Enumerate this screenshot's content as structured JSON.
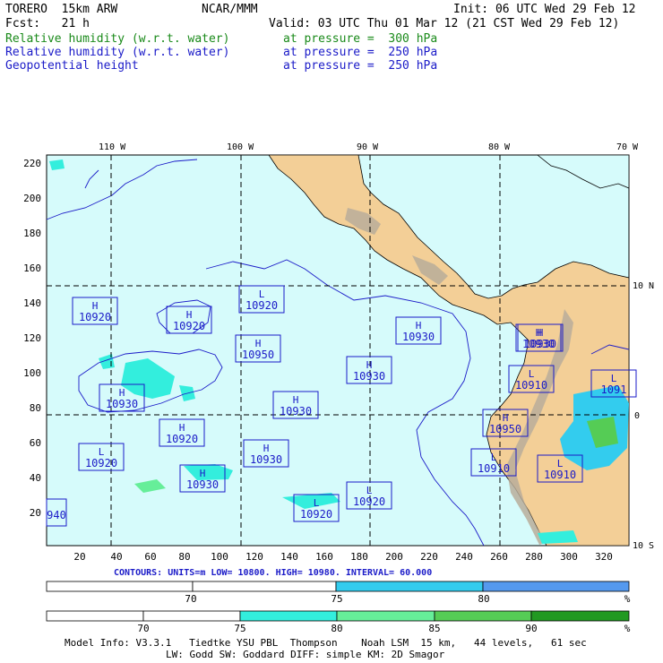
{
  "header": {
    "model": "TORERO  15km ARW",
    "org": "NCAR/MMM",
    "init": "Init: 06 UTC Wed 29 Feb 12",
    "fcst": "Fcst:   21 h",
    "valid": "Valid: 03 UTC Thu 01 Mar 12 (21 CST Wed 29 Feb 12)",
    "fields": [
      {
        "name": "Relative humidity (w.r.t. water)",
        "level": "at pressure =  300 hPa",
        "color": "#1a8a1a"
      },
      {
        "name": "Relative humidity (w.r.t. water)",
        "level": "at pressure =  250 hPa",
        "color": "#1b1bc8"
      },
      {
        "name": "Geopotential height",
        "level": "at pressure =  250 hPa",
        "color": "#1b1bc8"
      }
    ]
  },
  "map": {
    "lon_labels": [
      "110 W",
      "100 W",
      "90 W",
      "80 W",
      "70 W"
    ],
    "lat_labels": [
      "10 N",
      "0",
      "10 S"
    ],
    "x_ticks": [
      "20",
      "40",
      "60",
      "80",
      "100",
      "120",
      "140",
      "160",
      "180",
      "200",
      "220",
      "240",
      "260",
      "280",
      "300",
      "320"
    ],
    "y_ticks": [
      "220",
      "200",
      "180",
      "160",
      "140",
      "120",
      "100",
      "80",
      "60",
      "40",
      "20"
    ],
    "ocean_color": "#d6fbfb",
    "land_color": "#f3cf97",
    "centers": [
      {
        "type": "H",
        "value": "10920"
      },
      {
        "type": "H",
        "value": "10920"
      },
      {
        "type": "L",
        "value": "10920"
      },
      {
        "type": "H",
        "value": "10950"
      },
      {
        "type": "H",
        "value": "10930"
      },
      {
        "type": "H",
        "value": "10930"
      },
      {
        "type": "H",
        "value": "10930"
      },
      {
        "type": "H",
        "value": "10930"
      },
      {
        "type": "H",
        "value": "10930"
      },
      {
        "type": "H",
        "value": "10920"
      },
      {
        "type": "L",
        "value": "10920"
      },
      {
        "type": "H",
        "value": "10930"
      },
      {
        "type": "H",
        "value": "10930"
      },
      {
        "type": "L",
        "value": "10920"
      },
      {
        "type": "L",
        "value": "10920"
      },
      {
        "type": "H",
        "value": "10930"
      },
      {
        "type": "L",
        "value": "10910"
      },
      {
        "type": "H",
        "value": "10950"
      },
      {
        "type": "L",
        "value": "10910"
      },
      {
        "type": "L",
        "value": "10910"
      },
      {
        "type": "L",
        "value": "1091"
      },
      {
        "type": "",
        "value": "940"
      }
    ]
  },
  "contours": {
    "label": "CONTOURS:  UNITS=m  LOW=  10800.       HIGH=  10980.     INTERVAL=   60.000"
  },
  "colorbar_250": {
    "ticks": [
      "70",
      "75",
      "80",
      "%"
    ],
    "colors": [
      "#ffffff",
      "#ffffff",
      "#33ccee",
      "#5599ee"
    ]
  },
  "colorbar_300": {
    "ticks": [
      "70",
      "75",
      "80",
      "85",
      "90",
      "%"
    ],
    "colors": [
      "#ffffff",
      "#ffffff",
      "#33eedd",
      "#66ee99",
      "#55cc55",
      "#229922"
    ]
  },
  "footer": {
    "line1": "Model Info: V3.3.1   Tiedtke YSU PBL  Thompson    Noah LSM  15 km,   44 levels,   61 sec",
    "line2": "LW: Godd SW: Goddard DIFF: simple KM: 2D Smagor"
  }
}
